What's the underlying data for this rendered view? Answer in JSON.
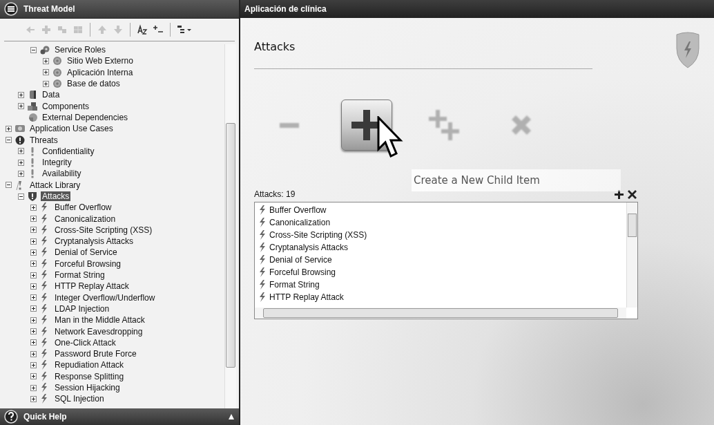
{
  "tree_panel": {
    "title": "Threat Model",
    "toolbar": [
      {
        "kind": "outdent",
        "disabled": true
      },
      {
        "kind": "add",
        "disabled": true
      },
      {
        "kind": "link",
        "disabled": true
      },
      {
        "kind": "grid",
        "disabled": true
      },
      {
        "kind": "separator"
      },
      {
        "kind": "up",
        "disabled": true
      },
      {
        "kind": "down",
        "disabled": true
      },
      {
        "kind": "separator"
      },
      {
        "kind": "sort",
        "disabled": false
      },
      {
        "kind": "expand",
        "disabled": false
      },
      {
        "kind": "separator"
      },
      {
        "kind": "view",
        "disabled": false
      }
    ],
    "tree": [
      {
        "children": [
          {
            "children": [
              {
                "label": "Service Roles",
                "kind": "roles",
                "expanded": true,
                "selected": false,
                "children": [
                  {
                    "label": "Sitio Web Externo",
                    "kind": "gear",
                    "expanded": false,
                    "selected": false
                  },
                  {
                    "label": "Aplicación Interna",
                    "kind": "gear",
                    "expanded": false,
                    "selected": false
                  },
                  {
                    "label": "Base de datos",
                    "kind": "gear",
                    "expanded": false,
                    "selected": false
                  }
                ]
              }
            ]
          },
          {
            "label": "Data",
            "kind": "data",
            "expanded": false,
            "selected": false
          },
          {
            "label": "Components",
            "kind": "components",
            "expanded": false,
            "selected": false
          },
          {
            "label": "External Dependencies",
            "kind": "external",
            "selected": false
          }
        ]
      },
      {
        "label": "Application Use Cases",
        "kind": "usecase",
        "expanded": false,
        "selected": false
      },
      {
        "label": "Threats",
        "kind": "threat",
        "expanded": true,
        "selected": false,
        "children": [
          {
            "label": "Confidentiality",
            "kind": "alert",
            "expanded": false,
            "selected": false
          },
          {
            "label": "Integrity",
            "kind": "alert",
            "expanded": false,
            "selected": false
          },
          {
            "label": "Availability",
            "kind": "alert",
            "expanded": false,
            "selected": false
          }
        ]
      },
      {
        "label": "Attack Library",
        "kind": "library",
        "expanded": true,
        "selected": false,
        "children": [
          {
            "label": "Attacks",
            "kind": "shield",
            "expanded": true,
            "selected": true,
            "children": [
              {
                "label": "Buffer Overflow",
                "kind": "attack",
                "expanded": false,
                "selected": false
              },
              {
                "label": "Canonicalization",
                "kind": "attack",
                "expanded": false,
                "selected": false
              },
              {
                "label": "Cross-Site Scripting (XSS)",
                "kind": "attack",
                "expanded": false,
                "selected": false
              },
              {
                "label": "Cryptanalysis Attacks",
                "kind": "attack",
                "expanded": false,
                "selected": false
              },
              {
                "label": "Denial of Service",
                "kind": "attack",
                "expanded": false,
                "selected": false
              },
              {
                "label": "Forceful Browsing",
                "kind": "attack",
                "expanded": false,
                "selected": false
              },
              {
                "label": "Format String",
                "kind": "attack",
                "expanded": false,
                "selected": false
              },
              {
                "label": "HTTP Replay Attack",
                "kind": "attack",
                "expanded": false,
                "selected": false
              },
              {
                "label": "Integer Overflow/Underflow",
                "kind": "attack",
                "expanded": false,
                "selected": false
              },
              {
                "label": "LDAP Injection",
                "kind": "attack",
                "expanded": false,
                "selected": false
              },
              {
                "label": "Man in the Middle Attack",
                "kind": "attack",
                "expanded": false,
                "selected": false
              },
              {
                "label": "Network Eavesdropping",
                "kind": "attack",
                "expanded": false,
                "selected": false
              },
              {
                "label": "One-Click Attack",
                "kind": "attack",
                "expanded": false,
                "selected": false
              },
              {
                "label": "Password Brute Force",
                "kind": "attack",
                "expanded": false,
                "selected": false
              },
              {
                "label": "Repudiation Attack",
                "kind": "attack",
                "expanded": false,
                "selected": false
              },
              {
                "label": "Response Splitting",
                "kind": "attack",
                "expanded": false,
                "selected": false
              },
              {
                "label": "Session Hijacking",
                "kind": "attack",
                "expanded": false,
                "selected": false
              },
              {
                "label": "SQL Injection",
                "kind": "attack",
                "expanded": false,
                "selected": false
              }
            ]
          }
        ]
      }
    ]
  },
  "quick_help": {
    "title": "Quick Help"
  },
  "main": {
    "title": "Aplicación de clínica",
    "heading": "Attacks",
    "actions": [
      {
        "kind": "back",
        "disabled": true
      },
      {
        "kind": "add",
        "disabled": false
      },
      {
        "kind": "add-child",
        "disabled": true
      },
      {
        "kind": "delete",
        "disabled": true
      }
    ],
    "tooltip": "Create a New Child Item",
    "list": {
      "caption": "Attacks: 19",
      "items": [
        "Buffer Overflow",
        "Canonicalization",
        "Cross-Site Scripting (XSS)",
        "Cryptanalysis Attacks",
        "Denial of Service",
        "Forceful Browsing",
        "Format String",
        "HTTP Replay Attack"
      ]
    }
  }
}
